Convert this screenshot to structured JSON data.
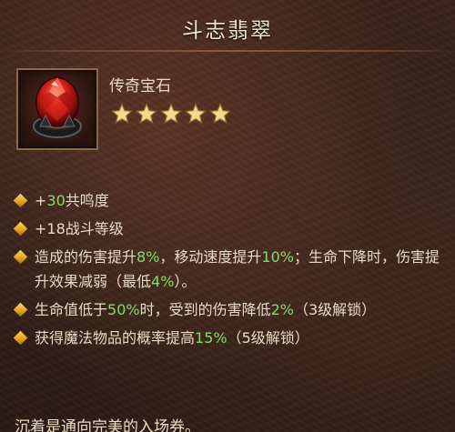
{
  "title": "斗志翡翠",
  "gem": {
    "name": "传奇宝石",
    "stars": 5,
    "icon": "legendary-red-gem-icon"
  },
  "colors": {
    "highlight": "#7ee06a",
    "text": "#e7dcc4",
    "bullet": "#f0b52a"
  },
  "bullets": [
    [
      {
        "t": "+",
        "h": false
      },
      {
        "t": "30",
        "h": true
      },
      {
        "t": "共鸣度",
        "h": false
      }
    ],
    [
      {
        "t": "+18战斗等级",
        "h": false
      }
    ],
    [
      {
        "t": "造成的伤害提升",
        "h": false
      },
      {
        "t": "8%",
        "h": true
      },
      {
        "t": "，移动速度提升",
        "h": false
      },
      {
        "t": "10%",
        "h": true
      },
      {
        "t": "；生命下降时，伤害提升效果减弱（最低",
        "h": false
      },
      {
        "t": "4%",
        "h": true
      },
      {
        "t": "）。",
        "h": false
      }
    ],
    [
      {
        "t": "生命值低于",
        "h": false
      },
      {
        "t": "50%",
        "h": true
      },
      {
        "t": "时，受到的伤害降低",
        "h": false
      },
      {
        "t": "2%",
        "h": true
      },
      {
        "t": "（3级解锁）",
        "h": false
      }
    ],
    [
      {
        "t": "获得魔法物品的概率提高",
        "h": false
      },
      {
        "t": "15%",
        "h": true
      },
      {
        "t": "（5级解锁）",
        "h": false
      }
    ]
  ],
  "flavor": "沉着是通向完美的入场券。"
}
